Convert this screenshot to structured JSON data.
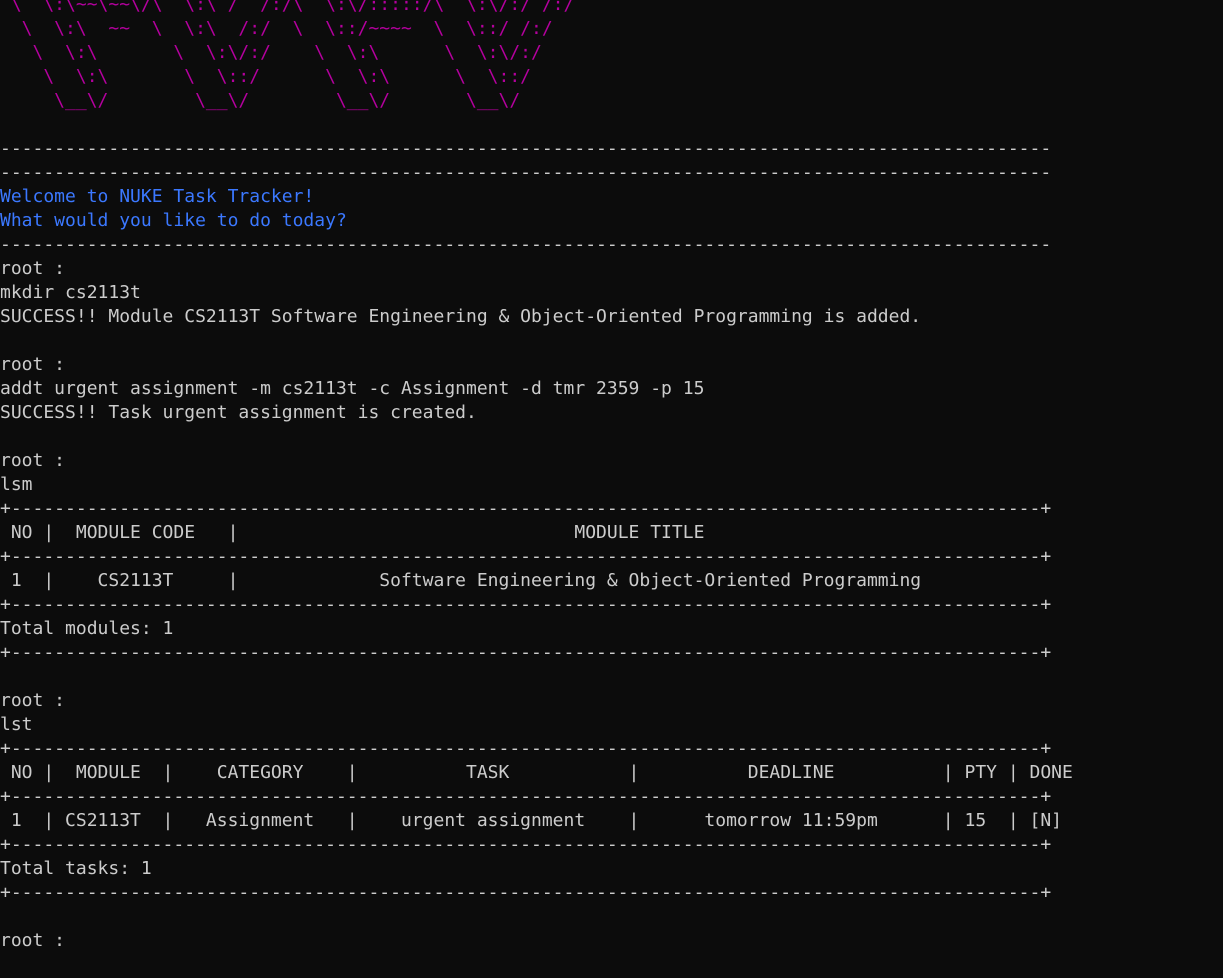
{
  "theme": {
    "background": "#0c0c0c",
    "foreground": "#cccccc",
    "banner_color": "#b4009e",
    "welcome_color": "#3b78ff"
  },
  "lines": [
    {
      "text": " \\  \\:\\~~\\~~\\/\\  \\:\\ /  /:/\\  \\:\\/:::::/\\  \\:\\/:/ /:/",
      "style": "art"
    },
    {
      "text": "  \\  \\:\\  ~~  \\  \\:\\  /:/  \\  \\::/~~~~  \\  \\::/ /:/",
      "style": "art"
    },
    {
      "text": "   \\  \\:\\       \\  \\:\\/:/    \\  \\:\\      \\  \\:\\/:/",
      "style": "art"
    },
    {
      "text": "    \\  \\:\\       \\  \\::/      \\  \\:\\      \\  \\::/",
      "style": "art"
    },
    {
      "text": "     \\__\\/        \\__\\/        \\__\\/       \\__\\/",
      "style": "art"
    },
    {
      "text": "",
      "style": "default"
    },
    {
      "text": "-------------------------------------------------------------------------------------------------",
      "style": "default"
    },
    {
      "text": "-------------------------------------------------------------------------------------------------",
      "style": "default"
    },
    {
      "text": "Welcome to NUKE Task Tracker!",
      "style": "welcome"
    },
    {
      "text": "What would you like to do today?",
      "style": "welcome"
    },
    {
      "text": "-------------------------------------------------------------------------------------------------",
      "style": "default"
    },
    {
      "text": "root :",
      "style": "default"
    },
    {
      "text": "mkdir cs2113t",
      "style": "default"
    },
    {
      "text": "SUCCESS!! Module CS2113T Software Engineering & Object-Oriented Programming is added.",
      "style": "default"
    },
    {
      "text": "",
      "style": "default"
    },
    {
      "text": "root :",
      "style": "default"
    },
    {
      "text": "addt urgent assignment -m cs2113t -c Assignment -d tmr 2359 -p 15",
      "style": "default"
    },
    {
      "text": "SUCCESS!! Task urgent assignment is created.",
      "style": "default"
    },
    {
      "text": "",
      "style": "default"
    },
    {
      "text": "root :",
      "style": "default"
    },
    {
      "text": "lsm",
      "style": "default"
    },
    {
      "text": "+-----------------------------------------------------------------------------------------------+",
      "style": "default"
    },
    {
      "text": " NO |  MODULE CODE   |                               MODULE TITLE",
      "style": "default"
    },
    {
      "text": "+-----------------------------------------------------------------------------------------------+",
      "style": "default"
    },
    {
      "text": " 1  |    CS2113T     |             Software Engineering & Object-Oriented Programming",
      "style": "default"
    },
    {
      "text": "+-----------------------------------------------------------------------------------------------+",
      "style": "default"
    },
    {
      "text": "Total modules: 1",
      "style": "default"
    },
    {
      "text": "+-----------------------------------------------------------------------------------------------+",
      "style": "default"
    },
    {
      "text": "",
      "style": "default"
    },
    {
      "text": "root :",
      "style": "default"
    },
    {
      "text": "lst",
      "style": "default"
    },
    {
      "text": "+-----------------------------------------------------------------------------------------------+",
      "style": "default"
    },
    {
      "text": " NO |  MODULE  |    CATEGORY    |          TASK           |          DEADLINE          | PTY | DONE",
      "style": "default"
    },
    {
      "text": "+-----------------------------------------------------------------------------------------------+",
      "style": "default"
    },
    {
      "text": " 1  | CS2113T  |   Assignment   |    urgent assignment    |      tomorrow 11:59pm      | 15  | [N]",
      "style": "default"
    },
    {
      "text": "+-----------------------------------------------------------------------------------------------+",
      "style": "default"
    },
    {
      "text": "Total tasks: 1",
      "style": "default"
    },
    {
      "text": "+-----------------------------------------------------------------------------------------------+",
      "style": "default"
    },
    {
      "text": "",
      "style": "default"
    },
    {
      "text": "root :",
      "style": "default"
    }
  ]
}
